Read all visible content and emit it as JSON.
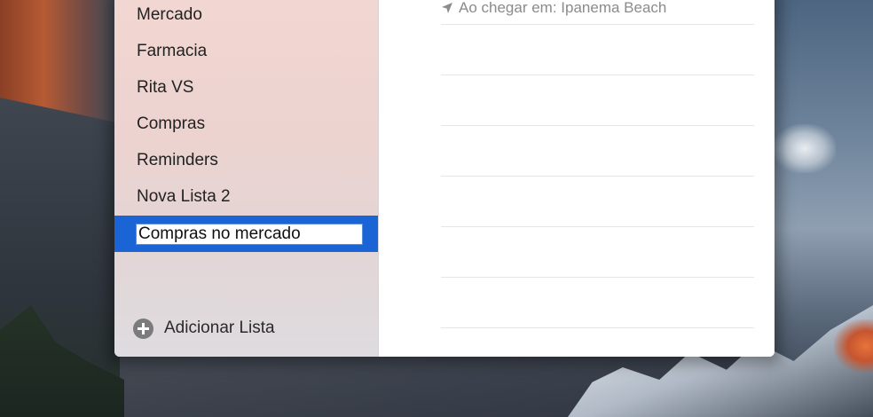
{
  "sidebar": {
    "items": [
      {
        "label": "Mercado"
      },
      {
        "label": "Farmacia"
      },
      {
        "label": "Rita VS"
      },
      {
        "label": "Compras"
      },
      {
        "label": "Reminders"
      },
      {
        "label": "Nova Lista 2"
      }
    ],
    "rename_field": {
      "value": "Compras no mercado"
    },
    "add_list_label": "Adicionar Lista"
  },
  "main": {
    "reminder_location": "Ao chegar em: Ipanema Beach"
  },
  "colors": {
    "selection": "#1a64d6",
    "sidebar_bg": "#f2d6d2"
  },
  "icons": {
    "add": "plus-circle-icon",
    "location": "location-arrow-icon"
  }
}
